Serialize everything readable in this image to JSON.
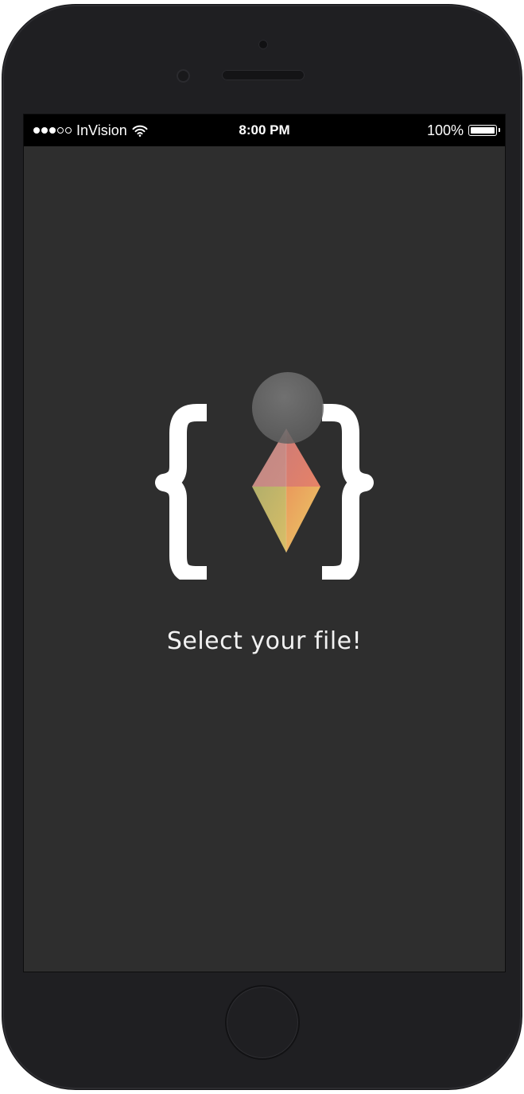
{
  "status_bar": {
    "signal_dots": [
      true,
      true,
      true,
      false,
      false
    ],
    "carrier": "InVision",
    "time": "8:00 PM",
    "battery_percent": "100%",
    "battery_level": 1.0
  },
  "main": {
    "prompt": "Select your file!"
  },
  "icons": {
    "wifi": "wifi-icon",
    "battery": "battery-icon",
    "logo": "curly-braces-crystal-logo",
    "home": "home-button"
  },
  "colors": {
    "screen_background": "#2e2e2e",
    "status_bar_background": "#000000",
    "phone_body": "#1f1f22",
    "text": "#f2f2f2"
  }
}
